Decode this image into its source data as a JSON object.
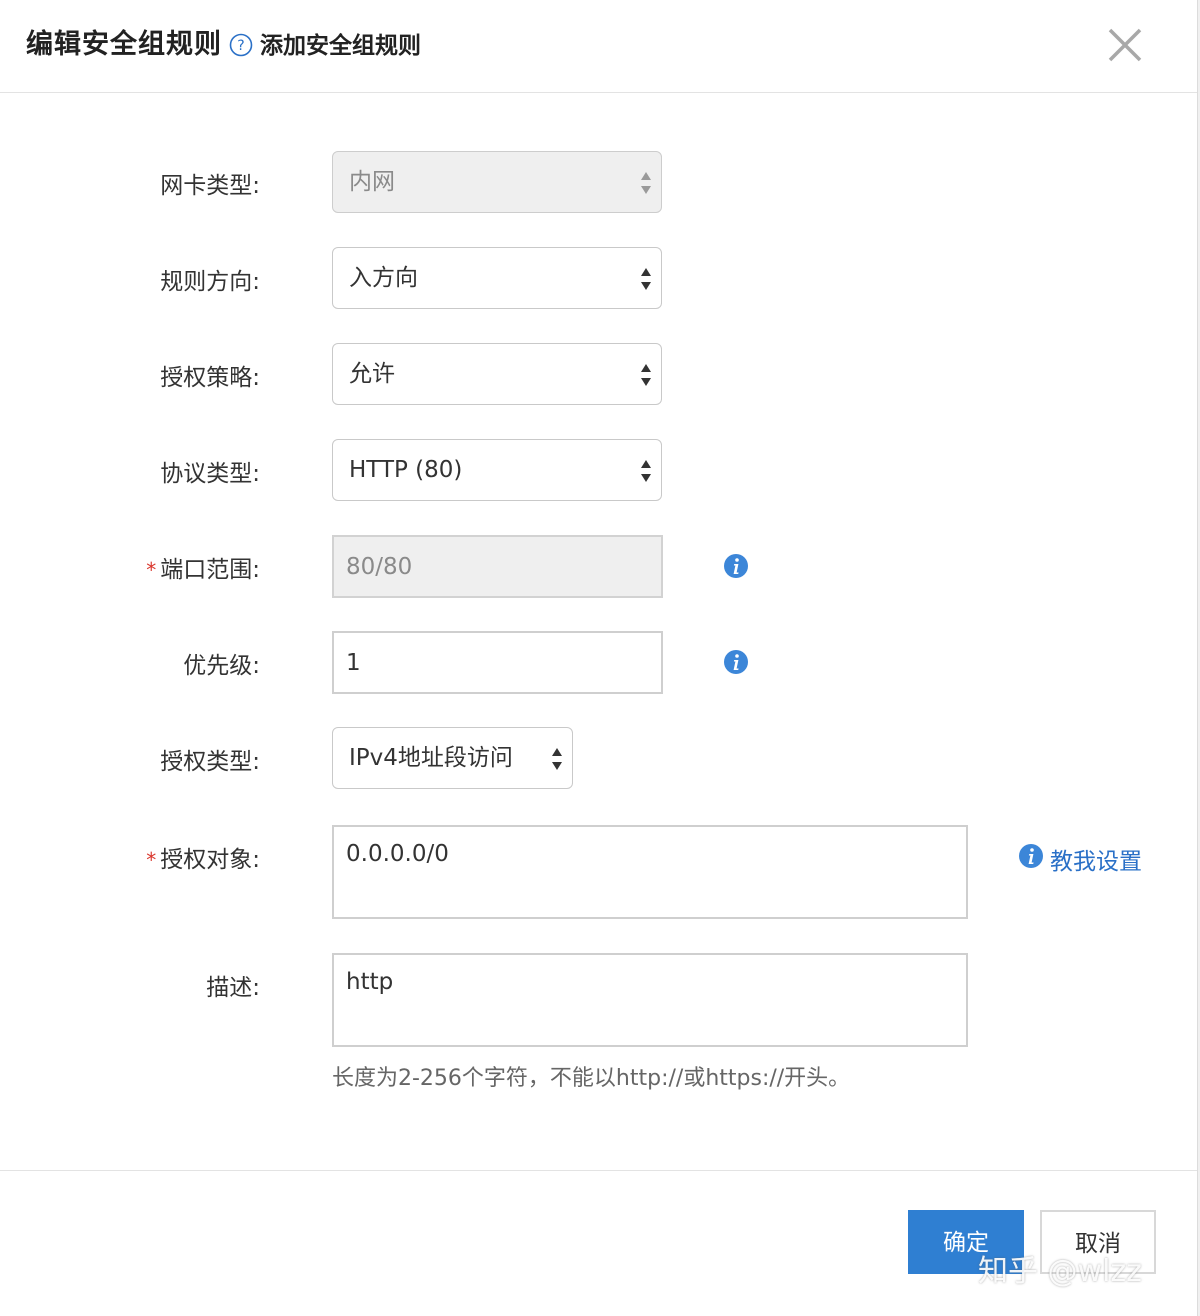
{
  "header": {
    "title": "编辑安全组规则",
    "help_link": "添加安全组规则"
  },
  "form": {
    "nic_type": {
      "label": "网卡类型:",
      "value": "内网",
      "disabled": true
    },
    "direction": {
      "label": "规则方向:",
      "value": "入方向"
    },
    "policy": {
      "label": "授权策略:",
      "value": "允许"
    },
    "protocol": {
      "label": "协议类型:",
      "value": "HTTP (80)"
    },
    "port_range": {
      "required_mark": "*",
      "label": "端口范围:",
      "value": "80/80",
      "disabled": true
    },
    "priority": {
      "label": "优先级:",
      "value": "1"
    },
    "auth_type": {
      "label": "授权类型:",
      "value": "IPv4地址段访问"
    },
    "auth_object": {
      "required_mark": "*",
      "label": "授权对象:",
      "value": "0.0.0.0/0",
      "help_link": "教我设置"
    },
    "description": {
      "label": "描述:",
      "value": "http",
      "hint": "长度为2-256个字符，不能以http://或https://开头。"
    }
  },
  "footer": {
    "ok_label": "确定",
    "cancel_label": "取消"
  },
  "watermark": "知乎 @wlzz",
  "colors": {
    "primary": "#2f7fd2",
    "link": "#2a70c7",
    "required": "#d9362c",
    "info": "#3c86d8"
  }
}
